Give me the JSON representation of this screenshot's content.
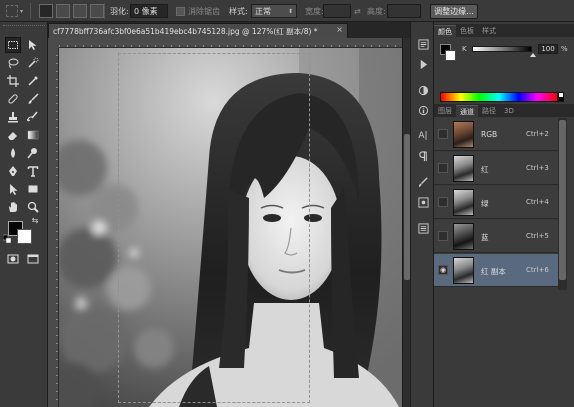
{
  "options_bar": {
    "feather_label": "羽化:",
    "feather_value": "0 像素",
    "antialias_label": "消除锯齿",
    "style_label": "样式:",
    "style_value": "正常",
    "width_label": "宽度:",
    "height_label": "高度:",
    "refine_edge_label": "调整边缘..."
  },
  "document": {
    "tab_title": "cf7778bff736afc3bf0e6a51b419ebc4b745128.jpg @ 127%(红 副本/8) *",
    "close_glyph": "×"
  },
  "colors": {
    "foreground": "#000000",
    "background": "#ffffff",
    "selection_highlight": "#5a6a7e"
  },
  "panels": {
    "color_tabs": [
      "颜色",
      "色板",
      "样式"
    ],
    "color_channel_label": "K",
    "color_value": "100",
    "color_unit": "%",
    "layer_tabs": [
      "图层",
      "通道",
      "路径",
      "3D"
    ],
    "active_layer_tab": 1
  },
  "channels": [
    {
      "name": "RGB",
      "shortcut": "Ctrl+2",
      "visible": false,
      "selected": false,
      "thumb": "color"
    },
    {
      "name": "红",
      "shortcut": "Ctrl+3",
      "visible": false,
      "selected": false,
      "thumb": "gray"
    },
    {
      "name": "绿",
      "shortcut": "Ctrl+4",
      "visible": false,
      "selected": false,
      "thumb": "gray"
    },
    {
      "name": "蓝",
      "shortcut": "Ctrl+5",
      "visible": false,
      "selected": false,
      "thumb": "dark"
    },
    {
      "name": "红 副本",
      "shortcut": "Ctrl+6",
      "visible": true,
      "selected": true,
      "thumb": "gray"
    }
  ],
  "tools": [
    "rect-marquee",
    "move",
    "lasso",
    "quick-select",
    "crop",
    "eyedropper",
    "healing",
    "brush",
    "clone-stamp",
    "history-brush",
    "eraser",
    "gradient",
    "blur",
    "dodge",
    "pen",
    "type",
    "path-select",
    "rectangle-shape",
    "hand",
    "zoom"
  ],
  "icons": {
    "eye": "eye-icon",
    "close": "close-icon"
  }
}
